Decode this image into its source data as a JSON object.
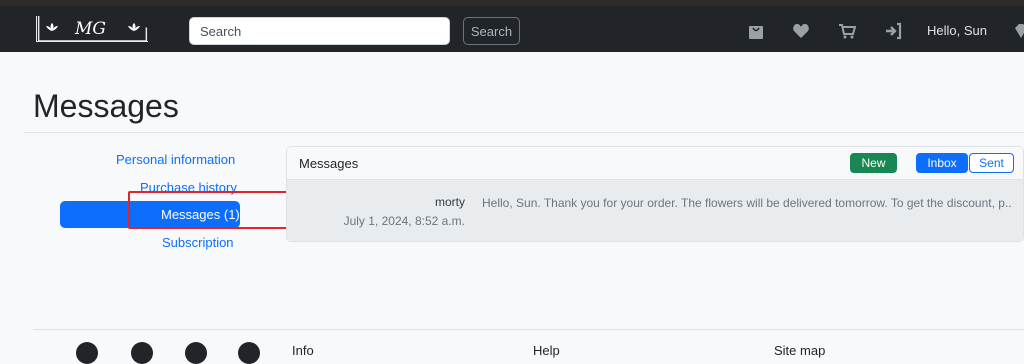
{
  "navbar": {
    "logo_text": "MG",
    "search_placeholder": "Search",
    "search_button": "Search",
    "icons": [
      "shopping-bag-icon",
      "heart-icon",
      "cart-icon",
      "sign-out-icon"
    ],
    "greeting": "Hello, Sun",
    "gem_icon": "diamond-icon"
  },
  "page": {
    "title": "Messages"
  },
  "sidebar": {
    "items": [
      {
        "label": "Personal information",
        "active": false
      },
      {
        "label": "Purchase history",
        "active": false
      },
      {
        "label": "Messages (1)",
        "active": true
      },
      {
        "label": "Subscription",
        "active": false
      }
    ]
  },
  "messages_card": {
    "title": "Messages",
    "new_button": "New",
    "inbox_button": "Inbox",
    "sent_button": "Sent",
    "rows": [
      {
        "sender": "morty",
        "date": "July 1, 2024, 8:52 a.m.",
        "preview": "Hello, Sun. Thank you for your order. The flowers will be delivered tomorrow. To get the discount, p.."
      }
    ]
  },
  "footer": {
    "social_icons": [
      "facebook-icon",
      "twitter-icon",
      "instagram-icon",
      "youtube-icon"
    ],
    "columns": [
      "Info",
      "Help",
      "Site map"
    ]
  },
  "colors": {
    "navbar_bg": "#212529",
    "primary": "#0d6efd",
    "success": "#198754",
    "highlight_red": "#e0242a"
  }
}
